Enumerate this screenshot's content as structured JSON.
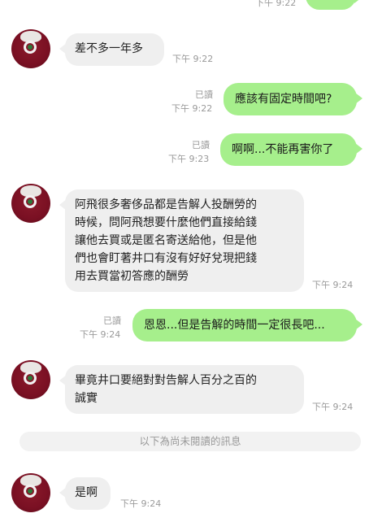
{
  "top_partial": {
    "time": "下午 9:22"
  },
  "messages": [
    {
      "id": "m1",
      "side": "in",
      "text": "差不多一年多",
      "time": "下午 9:22"
    },
    {
      "id": "m2",
      "side": "out",
      "text": "應該有固定時間吧?",
      "read": "已讀",
      "time": "下午 9:22"
    },
    {
      "id": "m3",
      "side": "out",
      "text": "啊啊...不能再害你了",
      "read": "已讀",
      "time": "下午 9:23"
    },
    {
      "id": "m4",
      "side": "in",
      "lines": [
        "阿飛很多奢侈品都是告解人投酬勞的",
        "時候，問阿飛想要什麼他們直接給錢",
        "讓他去買或是匿名寄送給他，但是他",
        "們也會盯著井口有沒有好好兌現把錢",
        "用去買當初答應的酬勞"
      ],
      "time": "下午 9:24"
    },
    {
      "id": "m5",
      "side": "out",
      "text": "恩恩...但是告解的時間一定很長吧...",
      "read": "已讀",
      "time": "下午 9:24"
    },
    {
      "id": "m6",
      "side": "in",
      "lines": [
        "畢竟井口要絕對對告解人百分之百的",
        "誠實"
      ],
      "time": "下午 9:24"
    },
    {
      "id": "m7",
      "side": "in",
      "text": "是啊",
      "time": "下午 9:24"
    }
  ],
  "unread_divider": "以下為尚未閱讀的訊息",
  "colors": {
    "outgoing_bubble": "#a6ef8c",
    "incoming_bubble": "#efefef",
    "meta_text": "#9a9a9a"
  }
}
